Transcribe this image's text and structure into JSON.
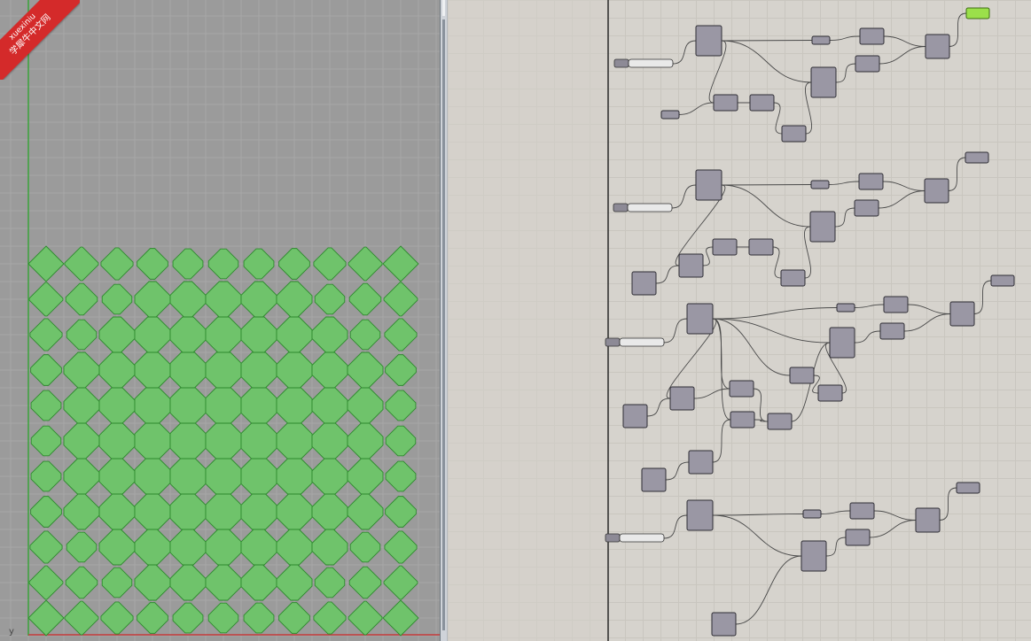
{
  "watermark": {
    "brand_roman": "xuexiniu",
    "brand_cn": "学犀牛中文网",
    "color": "#d42a2a"
  },
  "viewport": {
    "axis_label": "y",
    "background": "#9b9b9b",
    "pattern_fill": "#6fc36b",
    "pattern_stroke": "#2e8a2e"
  },
  "canvas": {
    "background": "#d6d3cd",
    "component_fill": "#9a97a4",
    "active_component": "#9be04a"
  }
}
